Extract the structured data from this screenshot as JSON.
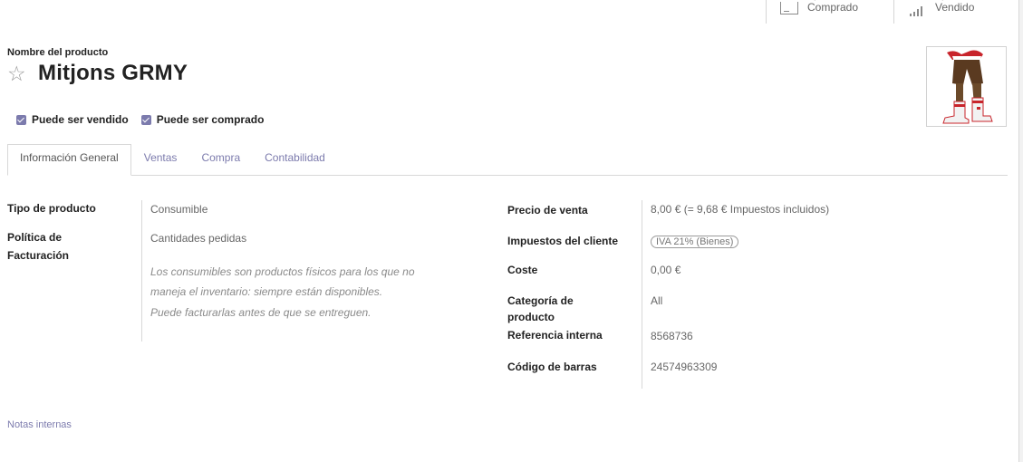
{
  "smart_buttons": [
    {
      "label": "Comprado",
      "icon": "purchase-card-icon"
    },
    {
      "label": "Vendido",
      "icon": "sales-bars-icon"
    }
  ],
  "header": {
    "field_label": "Nombre del producto",
    "product_name": "Mitjons GRMY",
    "star_icon": "☆"
  },
  "checks": {
    "sale_ok": "Puede ser vendido",
    "purchase_ok": "Puede ser comprado"
  },
  "tabs": [
    "Información General",
    "Ventas",
    "Compra",
    "Contabilidad"
  ],
  "general": {
    "type_label": "Tipo de producto",
    "type_value": "Consumible",
    "invoice_policy_label_1": "Política de",
    "invoice_policy_label_2": "Facturación",
    "invoice_policy_value": "Cantidades pedidas",
    "note_1": "Los consumibles son productos físicos para los que no",
    "note_2": "maneja el inventario: siempre están disponibles.",
    "note_3": "Puede facturarlas antes de que se entreguen."
  },
  "pricing": {
    "sale_price_label": "Precio de venta",
    "sale_price_value": "8,00 € (= 9,68 € Impuestos incluidos)",
    "customer_taxes_label": "Impuestos del cliente",
    "customer_taxes_value": "IVA 21% (Bienes)",
    "cost_label": "Coste",
    "cost_value": "0,00 €",
    "category_label_1": "Categoría de",
    "category_label_2": "producto",
    "category_value": "All",
    "internal_ref_label": "Referencia interna",
    "internal_ref_value": "8568736",
    "barcode_label": "Código de barras",
    "barcode_value": "24574963309"
  },
  "notes_tab": "Notas internas",
  "colors": {
    "accent": "#7c7bad",
    "text": "#222222",
    "muted": "#666666"
  }
}
